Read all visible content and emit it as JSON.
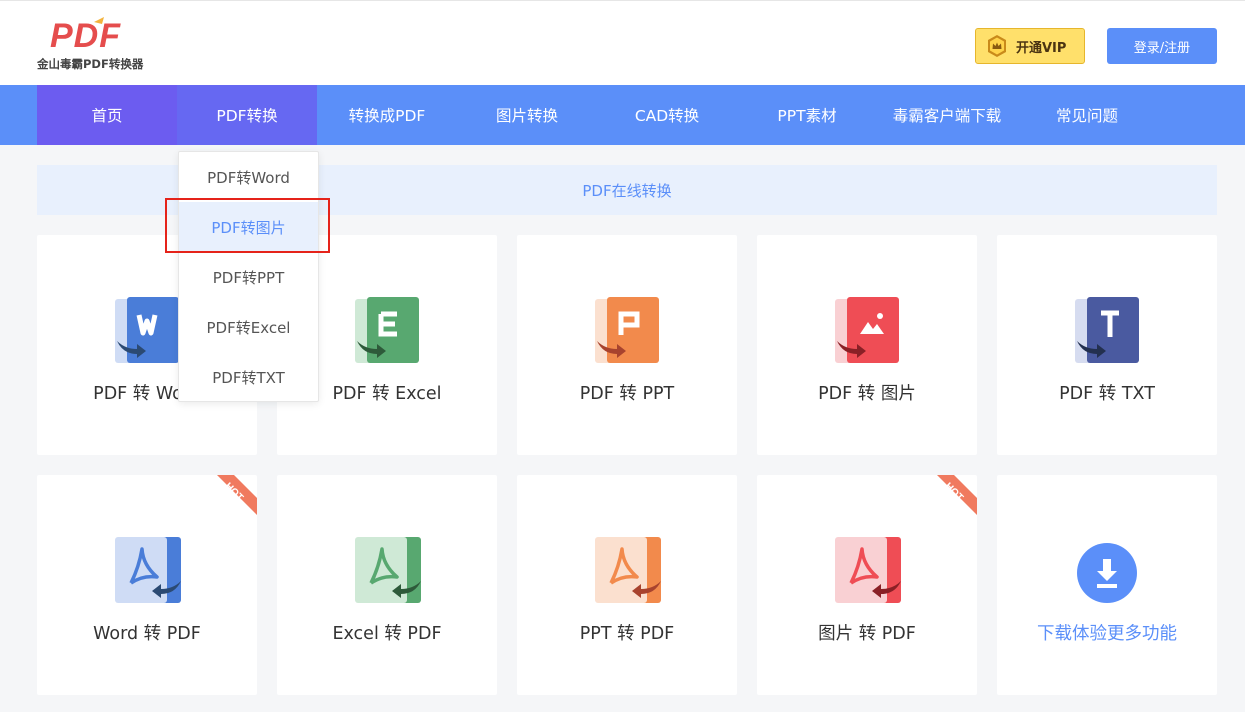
{
  "brand": {
    "logo_mark": "PDF",
    "logo_subtitle": "金山毒霸PDF转换器",
    "logo_color": "#e54d4d"
  },
  "header": {
    "vip_label": "开通VIP",
    "login_label": "登录/注册"
  },
  "nav": {
    "items": [
      {
        "label": "首页"
      },
      {
        "label": "PDF转换"
      },
      {
        "label": "转换成PDF"
      },
      {
        "label": "图片转换"
      },
      {
        "label": "CAD转换"
      },
      {
        "label": "PPT素材"
      },
      {
        "label": "毒霸客户端下载"
      },
      {
        "label": "常见问题"
      }
    ],
    "active_index": 1
  },
  "banner": {
    "title": "PDF在线转换"
  },
  "dropdown": {
    "items": [
      {
        "label": "PDF转Word"
      },
      {
        "label": "PDF转图片"
      },
      {
        "label": "PDF转PPT"
      },
      {
        "label": "PDF转Excel"
      },
      {
        "label": "PDF转TXT"
      }
    ],
    "highlighted_index": 1
  },
  "cards": {
    "row1": [
      {
        "label": "PDF 转 Word",
        "icon": "word-doc-icon",
        "color": "#4a7dd8"
      },
      {
        "label": "PDF 转 Excel",
        "icon": "excel-doc-icon",
        "color": "#58a870"
      },
      {
        "label": "PDF 转 PPT",
        "icon": "ppt-doc-icon",
        "color": "#f28a4c"
      },
      {
        "label": "PDF 转 图片",
        "icon": "image-doc-icon",
        "color": "#ef4d55"
      },
      {
        "label": "PDF 转 TXT",
        "icon": "txt-doc-icon",
        "color": "#4a5aa0"
      }
    ],
    "row2": [
      {
        "label": "Word 转 PDF",
        "icon": "word-to-pdf-icon",
        "color": "#4a7dd8",
        "badge": "HOT"
      },
      {
        "label": "Excel 转 PDF",
        "icon": "excel-to-pdf-icon",
        "color": "#58a870"
      },
      {
        "label": "PPT 转 PDF",
        "icon": "ppt-to-pdf-icon",
        "color": "#f28a4c"
      },
      {
        "label": "图片 转 PDF",
        "icon": "image-to-pdf-icon",
        "color": "#ef4d55",
        "badge": "HOT"
      },
      {
        "label": "下载体验更多功能",
        "icon": "download-icon",
        "color": "#5b8ff9"
      }
    ]
  }
}
